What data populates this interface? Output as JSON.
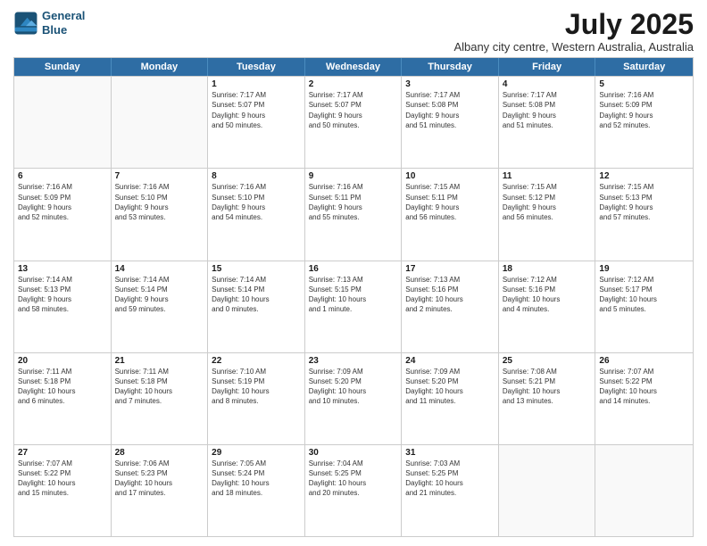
{
  "header": {
    "logo_line1": "General",
    "logo_line2": "Blue",
    "month": "July 2025",
    "location": "Albany city centre, Western Australia, Australia"
  },
  "days": [
    "Sunday",
    "Monday",
    "Tuesday",
    "Wednesday",
    "Thursday",
    "Friday",
    "Saturday"
  ],
  "rows": [
    [
      {
        "day": "",
        "info": ""
      },
      {
        "day": "",
        "info": ""
      },
      {
        "day": "1",
        "info": "Sunrise: 7:17 AM\nSunset: 5:07 PM\nDaylight: 9 hours\nand 50 minutes."
      },
      {
        "day": "2",
        "info": "Sunrise: 7:17 AM\nSunset: 5:07 PM\nDaylight: 9 hours\nand 50 minutes."
      },
      {
        "day": "3",
        "info": "Sunrise: 7:17 AM\nSunset: 5:08 PM\nDaylight: 9 hours\nand 51 minutes."
      },
      {
        "day": "4",
        "info": "Sunrise: 7:17 AM\nSunset: 5:08 PM\nDaylight: 9 hours\nand 51 minutes."
      },
      {
        "day": "5",
        "info": "Sunrise: 7:16 AM\nSunset: 5:09 PM\nDaylight: 9 hours\nand 52 minutes."
      }
    ],
    [
      {
        "day": "6",
        "info": "Sunrise: 7:16 AM\nSunset: 5:09 PM\nDaylight: 9 hours\nand 52 minutes."
      },
      {
        "day": "7",
        "info": "Sunrise: 7:16 AM\nSunset: 5:10 PM\nDaylight: 9 hours\nand 53 minutes."
      },
      {
        "day": "8",
        "info": "Sunrise: 7:16 AM\nSunset: 5:10 PM\nDaylight: 9 hours\nand 54 minutes."
      },
      {
        "day": "9",
        "info": "Sunrise: 7:16 AM\nSunset: 5:11 PM\nDaylight: 9 hours\nand 55 minutes."
      },
      {
        "day": "10",
        "info": "Sunrise: 7:15 AM\nSunset: 5:11 PM\nDaylight: 9 hours\nand 56 minutes."
      },
      {
        "day": "11",
        "info": "Sunrise: 7:15 AM\nSunset: 5:12 PM\nDaylight: 9 hours\nand 56 minutes."
      },
      {
        "day": "12",
        "info": "Sunrise: 7:15 AM\nSunset: 5:13 PM\nDaylight: 9 hours\nand 57 minutes."
      }
    ],
    [
      {
        "day": "13",
        "info": "Sunrise: 7:14 AM\nSunset: 5:13 PM\nDaylight: 9 hours\nand 58 minutes."
      },
      {
        "day": "14",
        "info": "Sunrise: 7:14 AM\nSunset: 5:14 PM\nDaylight: 9 hours\nand 59 minutes."
      },
      {
        "day": "15",
        "info": "Sunrise: 7:14 AM\nSunset: 5:14 PM\nDaylight: 10 hours\nand 0 minutes."
      },
      {
        "day": "16",
        "info": "Sunrise: 7:13 AM\nSunset: 5:15 PM\nDaylight: 10 hours\nand 1 minute."
      },
      {
        "day": "17",
        "info": "Sunrise: 7:13 AM\nSunset: 5:16 PM\nDaylight: 10 hours\nand 2 minutes."
      },
      {
        "day": "18",
        "info": "Sunrise: 7:12 AM\nSunset: 5:16 PM\nDaylight: 10 hours\nand 4 minutes."
      },
      {
        "day": "19",
        "info": "Sunrise: 7:12 AM\nSunset: 5:17 PM\nDaylight: 10 hours\nand 5 minutes."
      }
    ],
    [
      {
        "day": "20",
        "info": "Sunrise: 7:11 AM\nSunset: 5:18 PM\nDaylight: 10 hours\nand 6 minutes."
      },
      {
        "day": "21",
        "info": "Sunrise: 7:11 AM\nSunset: 5:18 PM\nDaylight: 10 hours\nand 7 minutes."
      },
      {
        "day": "22",
        "info": "Sunrise: 7:10 AM\nSunset: 5:19 PM\nDaylight: 10 hours\nand 8 minutes."
      },
      {
        "day": "23",
        "info": "Sunrise: 7:09 AM\nSunset: 5:20 PM\nDaylight: 10 hours\nand 10 minutes."
      },
      {
        "day": "24",
        "info": "Sunrise: 7:09 AM\nSunset: 5:20 PM\nDaylight: 10 hours\nand 11 minutes."
      },
      {
        "day": "25",
        "info": "Sunrise: 7:08 AM\nSunset: 5:21 PM\nDaylight: 10 hours\nand 13 minutes."
      },
      {
        "day": "26",
        "info": "Sunrise: 7:07 AM\nSunset: 5:22 PM\nDaylight: 10 hours\nand 14 minutes."
      }
    ],
    [
      {
        "day": "27",
        "info": "Sunrise: 7:07 AM\nSunset: 5:22 PM\nDaylight: 10 hours\nand 15 minutes."
      },
      {
        "day": "28",
        "info": "Sunrise: 7:06 AM\nSunset: 5:23 PM\nDaylight: 10 hours\nand 17 minutes."
      },
      {
        "day": "29",
        "info": "Sunrise: 7:05 AM\nSunset: 5:24 PM\nDaylight: 10 hours\nand 18 minutes."
      },
      {
        "day": "30",
        "info": "Sunrise: 7:04 AM\nSunset: 5:25 PM\nDaylight: 10 hours\nand 20 minutes."
      },
      {
        "day": "31",
        "info": "Sunrise: 7:03 AM\nSunset: 5:25 PM\nDaylight: 10 hours\nand 21 minutes."
      },
      {
        "day": "",
        "info": ""
      },
      {
        "day": "",
        "info": ""
      }
    ]
  ]
}
